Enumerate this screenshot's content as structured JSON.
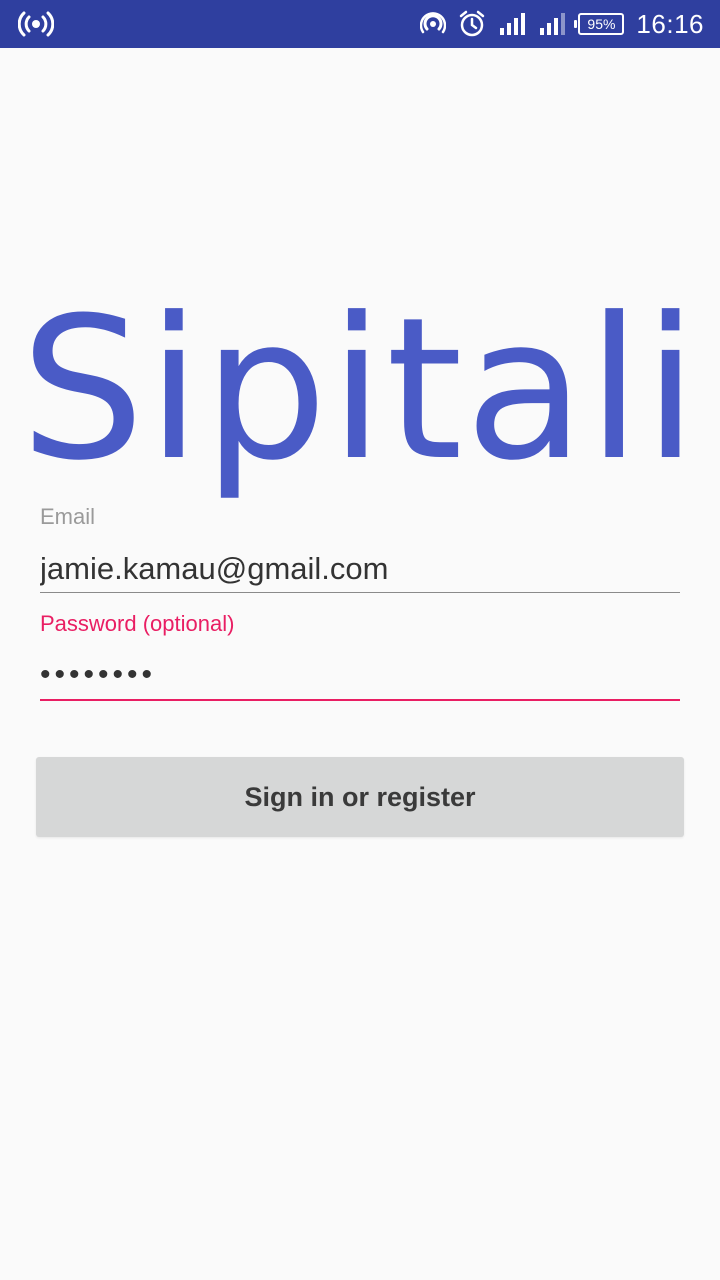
{
  "status_bar": {
    "battery_percent": "95%",
    "time": "16:16",
    "icons": [
      "broadcast-icon",
      "hotspot-icon",
      "alarm-icon",
      "signal-icon",
      "signal-icon-2",
      "battery-icon"
    ]
  },
  "app": {
    "logo_text": "Sipitali",
    "logo_color": "#4a5bc6"
  },
  "form": {
    "email_label": "Email",
    "email_value": "jamie.kamau@gmail.com",
    "password_label": "Password (optional)",
    "password_value": "••••••••",
    "accent_color": "#e91e63",
    "submit_label": "Sign in or register"
  }
}
